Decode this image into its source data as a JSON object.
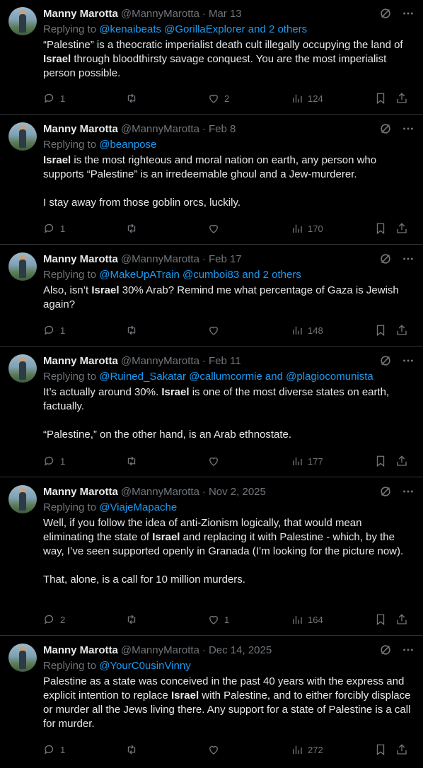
{
  "tweets": [
    {
      "name": "Manny Marotta",
      "handle": "@MannyMarotta",
      "date": "Mar 13",
      "replying_prefix": "Replying to ",
      "replying_to": "@kenaibeats @GorillaExplorer and 2 others",
      "text_parts": [
        "“Palestine” is a theocratic imperialist death cult illegally occupying the land of ",
        "Israel",
        " through bloodthirsty savage conquest. You are the most imperialist person possible."
      ],
      "replies": "1",
      "retweets": "",
      "likes": "2",
      "views": "124"
    },
    {
      "name": "Manny Marotta",
      "handle": "@MannyMarotta",
      "date": "Feb 8",
      "replying_prefix": "Replying to ",
      "replying_to": "@beanpose",
      "text_parts": [
        "",
        "Israel",
        " is the most righteous and moral nation on earth, any person who supports “Palestine” is an irredeemable ghoul and a Jew-murderer.\n\nI stay away from those goblin orcs, luckily."
      ],
      "replies": "1",
      "retweets": "",
      "likes": "",
      "views": "170"
    },
    {
      "name": "Manny Marotta",
      "handle": "@MannyMarotta",
      "date": "Feb 17",
      "replying_prefix": "Replying to ",
      "replying_to": "@MakeUpATrain @cumboi83 and 2 others",
      "text_parts": [
        "Also, isn’t ",
        "Israel",
        " 30% Arab? Remind me what percentage of Gaza is Jewish again?"
      ],
      "replies": "1",
      "retweets": "",
      "likes": "",
      "views": "148"
    },
    {
      "name": "Manny Marotta",
      "handle": "@MannyMarotta",
      "date": "Feb 11",
      "replying_prefix": "Replying to ",
      "replying_to": "@Ruined_Sakatar @callumcormie and @plagiocomunista",
      "text_parts": [
        "It’s actually around 30%. ",
        "Israel",
        " is one of the most diverse states on earth, factually.\n\n“Palestine,” on the other hand, is an Arab ethnostate."
      ],
      "replies": "1",
      "retweets": "",
      "likes": "",
      "views": "177"
    },
    {
      "name": "Manny Marotta",
      "handle": "@MannyMarotta",
      "date": "Nov 2, 2025",
      "replying_prefix": "Replying to ",
      "replying_to": "@ViajeMapache",
      "text_parts": [
        "Well, if you follow the idea of anti-Zionism logically, that would mean eliminating the state of ",
        "Israel",
        " and replacing it with Palestine - which, by the way, I’ve seen supported openly in Granada (I’m looking for the picture now).\n\nThat, alone, is a call for 10 million murders."
      ],
      "replies": "2",
      "retweets": "",
      "likes": "1",
      "views": "164"
    },
    {
      "name": "Manny Marotta",
      "handle": "@MannyMarotta",
      "date": "Dec 14, 2025",
      "replying_prefix": "Replying to ",
      "replying_to": "@YourC0usinVinny",
      "text_parts": [
        "Palestine as a state was conceived in the past 40 years with the express and explicit intention to replace ",
        "Israel",
        " with Palestine, and to either forcibly displace or murder all the Jews living there. Any support for a state of Palestine is a call for murder."
      ],
      "replies": "1",
      "retweets": "",
      "likes": "",
      "views": "272"
    }
  ],
  "colors": {
    "background": "#000000",
    "text": "#e7e9ea",
    "muted": "#71767b",
    "link": "#1d9bf0",
    "divider": "#2f3336"
  },
  "icons": [
    "grok-icon",
    "more-icon",
    "reply-icon",
    "retweet-icon",
    "like-icon",
    "views-icon",
    "bookmark-icon",
    "share-icon"
  ]
}
